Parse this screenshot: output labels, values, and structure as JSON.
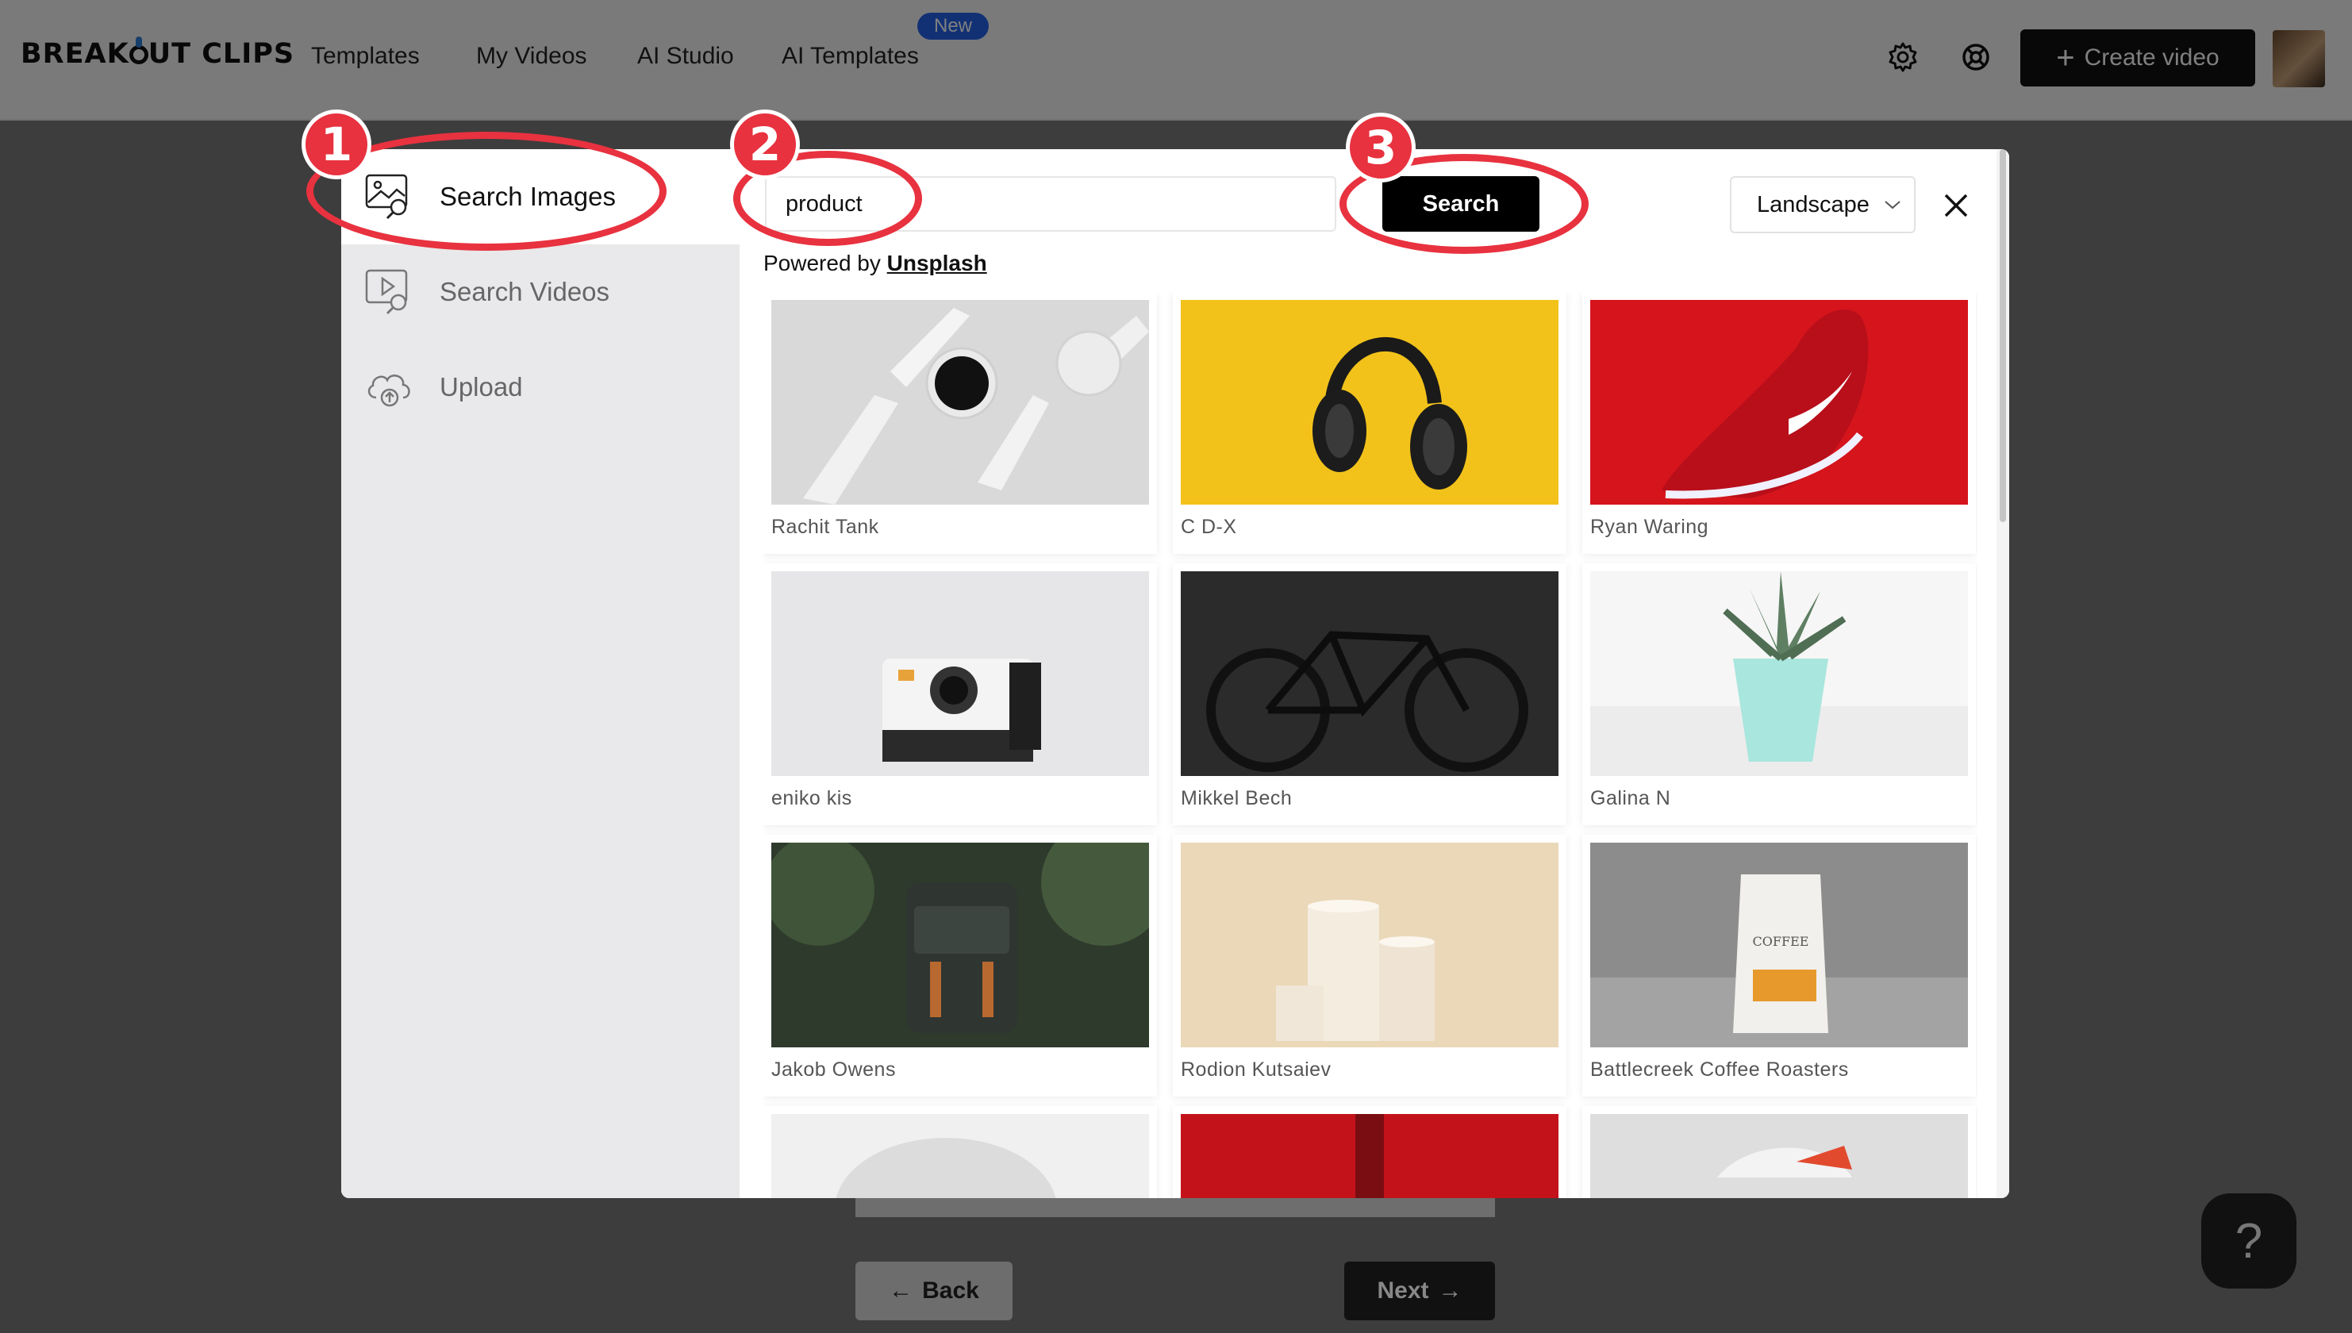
{
  "header": {
    "logo": "BREAKOUT CLIPS",
    "nav": [
      "Templates",
      "My Videos",
      "AI Studio",
      "AI Templates"
    ],
    "new_badge": "New",
    "create_label": "Create video"
  },
  "sidebar": {
    "items": [
      {
        "label": "Search Images",
        "icon": "image-search-icon",
        "active": true
      },
      {
        "label": "Search Videos",
        "icon": "video-search-icon",
        "active": false
      },
      {
        "label": "Upload",
        "icon": "cloud-upload-icon",
        "active": false
      }
    ]
  },
  "search": {
    "query": "product",
    "button_label": "Search",
    "orientation": "Landscape",
    "powered_prefix": "Powered by",
    "powered_link": "Unsplash"
  },
  "results": [
    {
      "credit": "Rachit Tank",
      "subject": "white smartwatch"
    },
    {
      "credit": "C D-X",
      "subject": "headphones on yellow"
    },
    {
      "credit": "Ryan Waring",
      "subject": "red sneaker"
    },
    {
      "credit": "eniko kis",
      "subject": "instant camera"
    },
    {
      "credit": "Mikkel Bech",
      "subject": "black bicycle"
    },
    {
      "credit": "Galina N",
      "subject": "succulent in mint pot"
    },
    {
      "credit": "Jakob Owens",
      "subject": "backpack"
    },
    {
      "credit": "Rodion Kutsaiev",
      "subject": "cream pedestals"
    },
    {
      "credit": "Battlecreek Coffee Roasters",
      "subject": "coffee bag"
    },
    {
      "credit": "",
      "subject": "white product"
    },
    {
      "credit": "",
      "subject": "bottle on red"
    },
    {
      "credit": "",
      "subject": "sneaker"
    }
  ],
  "annotations": [
    "1",
    "2",
    "3"
  ],
  "footer": {
    "back_label": "Back",
    "next_label": "Next",
    "help_label": "?"
  },
  "colors": {
    "annotation": "#e8323f",
    "badge": "#2563eb",
    "primary_button": "#000000"
  }
}
